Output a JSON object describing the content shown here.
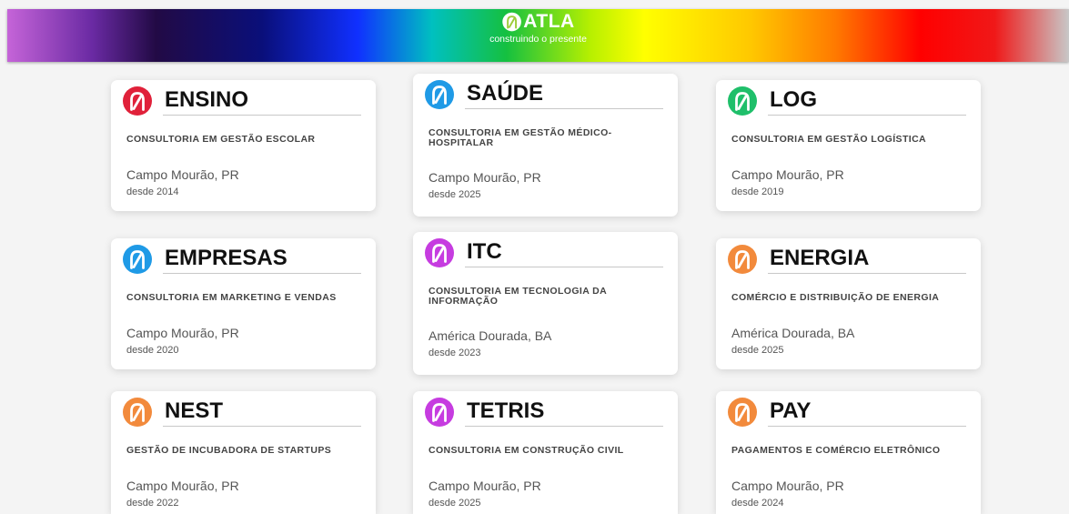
{
  "header": {
    "brand": "ATLA",
    "tagline": "construindo o presente"
  },
  "cards": [
    {
      "title": "ENSINO",
      "description": "CONSULTORIA EM GESTÃO ESCOLAR",
      "location": "Campo Mourão, PR",
      "since": "desde 2014",
      "icon": "atla-logo-icon",
      "color": "#e0213a"
    },
    {
      "title": "SAÚDE",
      "description": "CONSULTORIA EM GESTÃO MÉDICO-HOSPITALAR",
      "location": "Campo Mourão, PR",
      "since": "desde 2025",
      "icon": "atla-logo-icon",
      "color": "#1f9ae6"
    },
    {
      "title": "LOG",
      "description": "CONSULTORIA EM GESTÃO LOGÍSTICA",
      "location": "Campo Mourão, PR",
      "since": "desde 2019",
      "icon": "atla-logo-icon",
      "color": "#1fbf6a"
    },
    {
      "title": "EMPRESAS",
      "description": "CONSULTORIA EM MARKETING E VENDAS",
      "location": "Campo Mourão, PR",
      "since": "desde 2020",
      "icon": "atla-logo-icon",
      "color": "#1f9ae6"
    },
    {
      "title": "ITC",
      "description": "CONSULTORIA EM TECNOLOGIA DA INFORMAÇÃO",
      "location": "América Dourada, BA",
      "since": "desde 2023",
      "icon": "atla-logo-icon",
      "color": "#c63ce0"
    },
    {
      "title": "ENERGIA",
      "description": "COMÉRCIO E DISTRIBUIÇÃO DE ENERGIA",
      "location": "América Dourada, BA",
      "since": "desde 2025",
      "icon": "atla-logo-icon",
      "color": "#f28a3c"
    },
    {
      "title": "NEST",
      "description": "GESTÃO DE INCUBADORA DE STARTUPS",
      "location": "Campo Mourão, PR",
      "since": "desde 2022",
      "icon": "atla-logo-icon",
      "color": "#f28a3c"
    },
    {
      "title": "TETRIS",
      "description": "CONSULTORIA EM CONSTRUÇÃO CIVIL",
      "location": "Campo Mourão, PR",
      "since": "desde 2025",
      "icon": "atla-logo-icon",
      "color": "#c63ce0"
    },
    {
      "title": "PAY",
      "description": "PAGAMENTOS E COMÉRCIO ELETRÔNICO",
      "location": "Campo Mourão, PR",
      "since": "desde 2024",
      "icon": "atla-logo-icon",
      "color": "#f28a3c"
    }
  ]
}
